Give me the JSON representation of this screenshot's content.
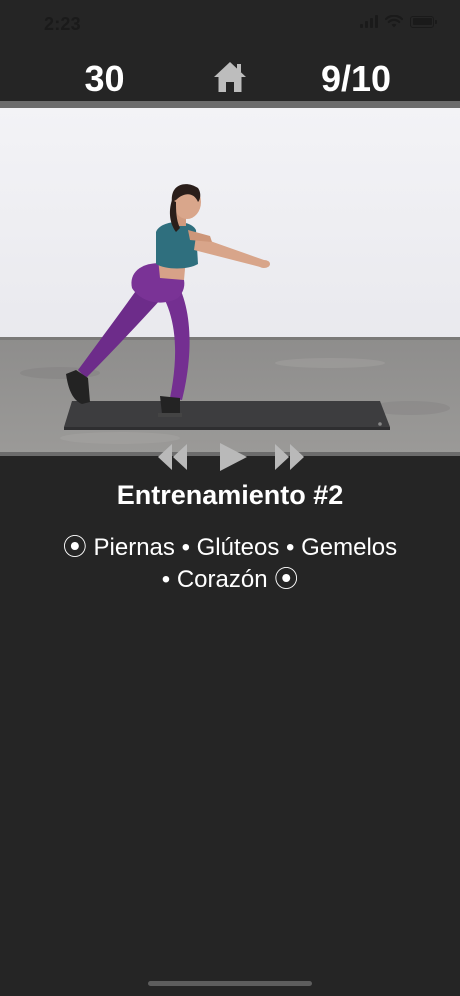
{
  "status_bar": {
    "time": "2:23",
    "icons": [
      "cellular-signal-icon",
      "wifi-icon",
      "battery-icon"
    ]
  },
  "header": {
    "timer": "30",
    "home_icon": "home-icon",
    "exercise_counter": "9/10"
  },
  "video": {
    "description_icon": "exercise-video"
  },
  "controls": {
    "icons": [
      "rewind-icon",
      "play-icon",
      "fast-forward-icon"
    ]
  },
  "workout": {
    "title": "Entrenamiento #2",
    "muscle_groups_line1": "⦿ Piernas • Glúteos • Gemelos",
    "muscle_groups_line2": "• Corazón ⦿"
  },
  "colors": {
    "background": "#252525",
    "divider": "#6c6c6c",
    "control_icon": "#b9b9b9",
    "text": "#ffffff"
  }
}
